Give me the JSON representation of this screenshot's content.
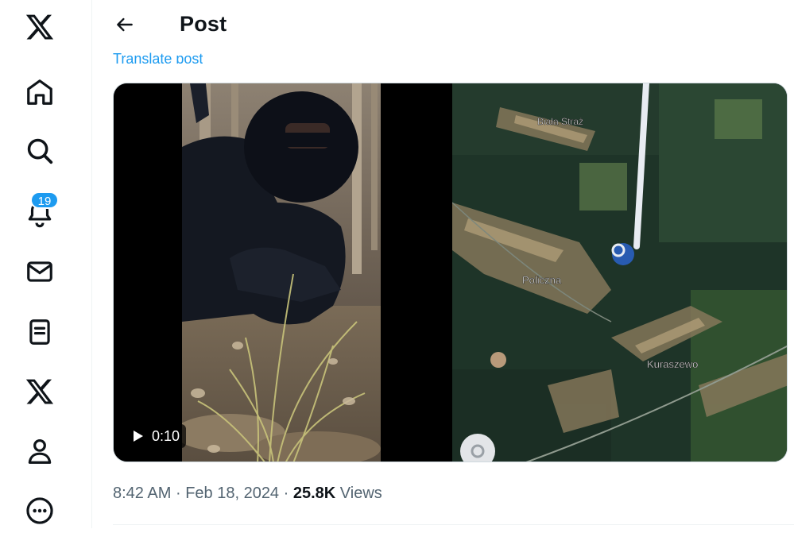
{
  "nav": {
    "items": [
      {
        "icon": "x-logo-icon"
      },
      {
        "icon": "home-icon"
      },
      {
        "icon": "search-icon"
      },
      {
        "icon": "bell-icon"
      },
      {
        "icon": "mail-icon"
      },
      {
        "icon": "lists-icon"
      },
      {
        "icon": "x-premium-icon"
      },
      {
        "icon": "profile-icon"
      },
      {
        "icon": "more-icon"
      }
    ],
    "notification_count": "19"
  },
  "header": {
    "title": "Post",
    "back_icon": "arrow-left-icon"
  },
  "post": {
    "translate_label": "Translate post",
    "media": {
      "duration": "0:10",
      "map_labels": [
        "Biała Straż",
        "Policzna",
        "Kuraszewo"
      ]
    },
    "time": "8:42 AM",
    "date": "Feb 18, 2024",
    "views_count": "25.8K",
    "views_label": "Views",
    "separator": "·"
  },
  "colors": {
    "accent": "#1d9bf0",
    "text": "#0f1419",
    "muted": "#536471"
  }
}
